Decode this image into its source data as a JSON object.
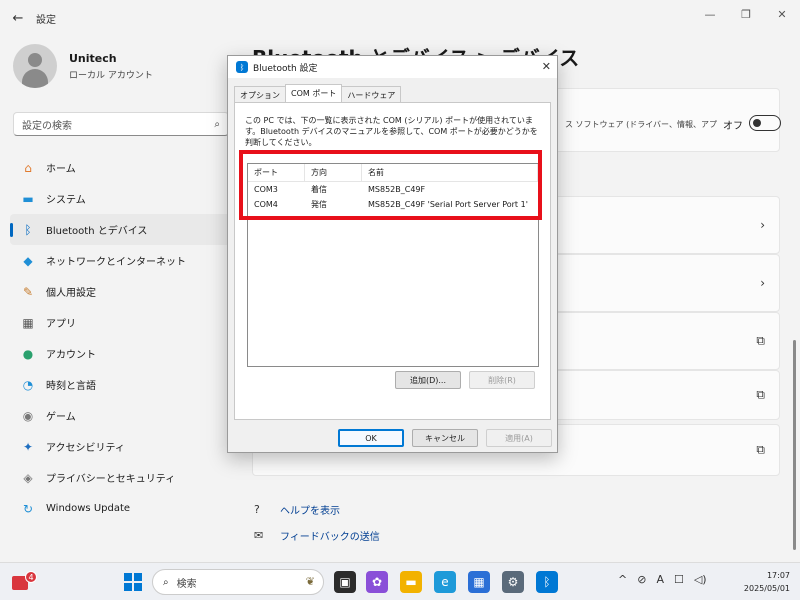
{
  "window": {
    "title": "設定",
    "back_glyph": "←",
    "minimize_glyph": "—",
    "maximize_glyph": "❐",
    "close_glyph": "✕"
  },
  "profile": {
    "name": "Unitech",
    "subtitle": "ローカル アカウント"
  },
  "search": {
    "placeholder": "設定の検索",
    "icon_glyph": "⌕"
  },
  "nav": {
    "items": [
      {
        "label": "ホーム",
        "icon": "home-icon",
        "glyph": "⌂",
        "color": "#e07a2e",
        "active": false
      },
      {
        "label": "システム",
        "icon": "system-icon",
        "glyph": "▬",
        "color": "#1f8fd6",
        "active": false
      },
      {
        "label": "Bluetooth とデバイス",
        "icon": "bluetooth-icon",
        "glyph": "ᛒ",
        "color": "#0067c0",
        "active": true
      },
      {
        "label": "ネットワークとインターネット",
        "icon": "wifi-icon",
        "glyph": "◆",
        "color": "#1f8fd6",
        "active": false
      },
      {
        "label": "個人用設定",
        "icon": "brush-icon",
        "glyph": "✎",
        "color": "#c57a2a",
        "active": false
      },
      {
        "label": "アプリ",
        "icon": "apps-icon",
        "glyph": "▦",
        "color": "#555555",
        "active": false
      },
      {
        "label": "アカウント",
        "icon": "account-icon",
        "glyph": "●",
        "color": "#2aa06d",
        "active": false
      },
      {
        "label": "時刻と言語",
        "icon": "time-language-icon",
        "glyph": "◔",
        "color": "#1f8fd6",
        "active": false
      },
      {
        "label": "ゲーム",
        "icon": "gaming-icon",
        "glyph": "◉",
        "color": "#777777",
        "active": false
      },
      {
        "label": "アクセシビリティ",
        "icon": "accessibility-icon",
        "glyph": "✦",
        "color": "#1f6fc0",
        "active": false
      },
      {
        "label": "プライバシーとセキュリティ",
        "icon": "shield-icon",
        "glyph": "◈",
        "color": "#777777",
        "active": false
      },
      {
        "label": "Windows Update",
        "icon": "windows-update-icon",
        "glyph": "↻",
        "color": "#1f8fd6",
        "active": false
      }
    ]
  },
  "main": {
    "title": "Bluetooth とデバイス > デバイス",
    "card1_desc": "ス ソフトウェア (ドライバー、情報、アプ",
    "card1_toggle_label": "オフ",
    "chevron_glyph": "›",
    "external_glyph": "⧉"
  },
  "help": {
    "help_label": "ヘルプを表示",
    "feedback_label": "フィードバックの送信"
  },
  "dialog": {
    "title": "Bluetooth 設定",
    "tabs": [
      "オプション",
      "COM ポート",
      "ハードウェア"
    ],
    "active_tab": 1,
    "intro": "この PC では、下の一覧に表示された COM (シリアル) ポートが使用されています。Bluetooth デバイスのマニュアルを参照して、COM ポートが必要かどうかを判断してください。",
    "columns": [
      "ポート",
      "方向",
      "名前"
    ],
    "rows": [
      {
        "port": "COM3",
        "direction": "着信",
        "name": "MS852B_C49F"
      },
      {
        "port": "COM4",
        "direction": "発信",
        "name": "MS852B_C49F 'Serial Port Server Port 1'"
      }
    ],
    "add_label": "追加(D)...",
    "remove_label": "削除(R)",
    "ok_label": "OK",
    "cancel_label": "キャンセル",
    "apply_label": "適用(A)",
    "close_glyph": "✕",
    "highlight_color": "#e8101a"
  },
  "taskbar": {
    "weather_badge": "4",
    "search_placeholder": "検索",
    "search_glyph": "⌕",
    "time": "17:07",
    "date": "2025/05/01",
    "tray_glyphs": [
      "^",
      "⊘",
      "A",
      "☐",
      "◁)"
    ]
  }
}
